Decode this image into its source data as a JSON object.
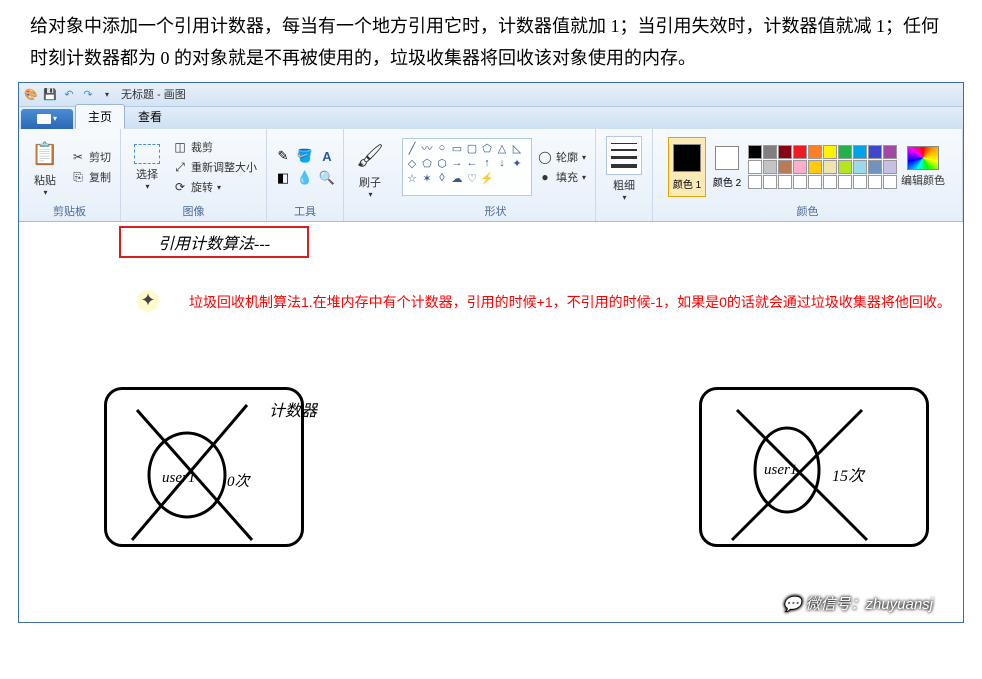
{
  "doc": {
    "text": "给对象中添加一个引用计数器，每当有一个地方引用它时，计数器值就加 1；当引用失效时，计数器值就减 1；任何时刻计数器都为 0 的对象就是不再被使用的，垃圾收集器将回收该对象使用的内存。"
  },
  "window": {
    "title": "无标题 - 画图"
  },
  "tabs": {
    "home": "主页",
    "view": "查看"
  },
  "ribbon": {
    "clipboard": {
      "paste": "粘贴",
      "cut": "剪切",
      "copy": "复制",
      "group": "剪贴板"
    },
    "image": {
      "select": "选择",
      "crop": "裁剪",
      "resize": "重新调整大小",
      "rotate": "旋转",
      "group": "图像"
    },
    "tools": {
      "brush": "刷子",
      "group": "工具"
    },
    "shapes": {
      "outline": "轮廓",
      "fill": "填充",
      "group": "形状"
    },
    "size": {
      "line": "粗细"
    },
    "colors": {
      "c1": "颜色 1",
      "c2": "颜色 2",
      "edit": "编辑颜色",
      "group": "颜色"
    }
  },
  "palette": {
    "row1": [
      "#000000",
      "#7f7f7f",
      "#880015",
      "#ed1c24",
      "#ff7f27",
      "#fff200",
      "#22b14c",
      "#00a2e8",
      "#3f48cc",
      "#a349a4"
    ],
    "row2": [
      "#ffffff",
      "#c3c3c3",
      "#b97a57",
      "#ffaec9",
      "#ffc90e",
      "#efe4b0",
      "#b5e61d",
      "#99d9ea",
      "#7092be",
      "#c8bfe7"
    ],
    "row3": [
      "#ffffff",
      "#ffffff",
      "#ffffff",
      "#ffffff",
      "#ffffff",
      "#ffffff",
      "#ffffff",
      "#ffffff",
      "#ffffff",
      "#ffffff"
    ]
  },
  "canvas": {
    "title": "引用计数算法---",
    "annotation": "垃圾回收机制算法1.在堆内存中有个计数器，引用的时候+1，不引用的时候-1，如果是0的话就会通过垃圾收集器将他回收。",
    "box1": {
      "label": "计数器",
      "user": "user1",
      "count": "0次"
    },
    "box2": {
      "user": "user1",
      "count": "15次"
    }
  },
  "watermark": "微信号：zhuyuansj"
}
